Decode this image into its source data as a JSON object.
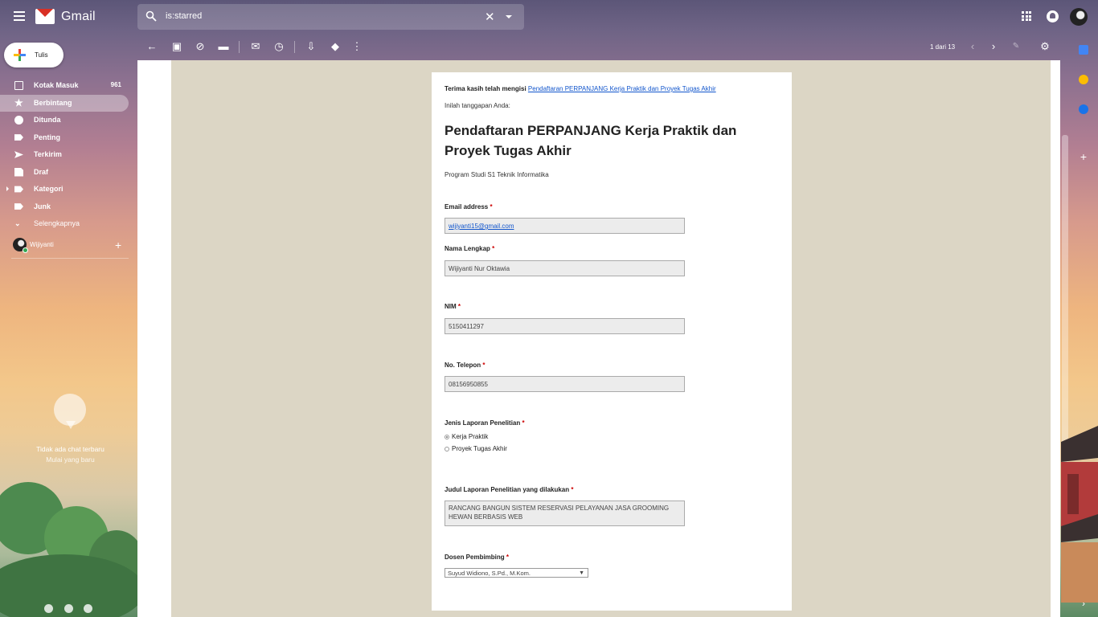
{
  "app": {
    "name": "Gmail"
  },
  "search": {
    "value": "is:starred"
  },
  "toolbar": {
    "pager": "1 dari 13"
  },
  "compose": {
    "label": "Tulis"
  },
  "sidebar": {
    "items": [
      {
        "label": "Kotak Masuk",
        "count": "961"
      },
      {
        "label": "Berbintang",
        "count": ""
      },
      {
        "label": "Ditunda",
        "count": ""
      },
      {
        "label": "Penting",
        "count": ""
      },
      {
        "label": "Terkirim",
        "count": ""
      },
      {
        "label": "Draf",
        "count": ""
      },
      {
        "label": "Kategori",
        "count": ""
      },
      {
        "label": "Junk",
        "count": ""
      },
      {
        "label": "Selengkapnya",
        "count": ""
      }
    ],
    "user": "Wijiyanti"
  },
  "chat": {
    "empty": "Tidak ada chat terbaru",
    "start": "Mulai yang baru"
  },
  "form": {
    "intro": "Terima kasih telah mengisi",
    "intro_link": "Pendaftaran PERPANJANG Kerja Praktik dan Proyek Tugas Akhir",
    "sub": "Inilah tanggapan Anda:",
    "title": "Pendaftaran PERPANJANG Kerja Praktik dan Proyek Tugas Akhir",
    "desc": "Program Studi S1 Teknik Informatika",
    "req_mark": "*",
    "email_label": "Email address",
    "email_value": "wijiyanti15@gmail.com",
    "name_label": "Nama Lengkap",
    "name_value": "Wijiyanti Nur Oktawia",
    "nim_label": "NIM",
    "nim_value": "5150411297",
    "phone_label": "No. Telepon",
    "phone_value": "08156950855",
    "report_label": "Jenis Laporan Penelitian",
    "report_options": [
      "Kerja Praktik",
      "Proyek Tugas Akhir"
    ],
    "report_selected": "Kerja Praktik",
    "judul_label": "Judul Laporan Penelitian yang dilakukan",
    "judul_value": "RANCANG BANGUN SISTEM RESERVASI PELAYANAN JASA GROOMING HEWAN  BERBASIS WEB",
    "dosen_label": "Dosen Pembimbing",
    "dosen_value": "Suyud Widiono, S.Pd., M.Kom."
  },
  "colors": {
    "accent": "#d93025",
    "link": "#1155cc",
    "active_nav": "rgba(255,255,255,0.35)"
  }
}
